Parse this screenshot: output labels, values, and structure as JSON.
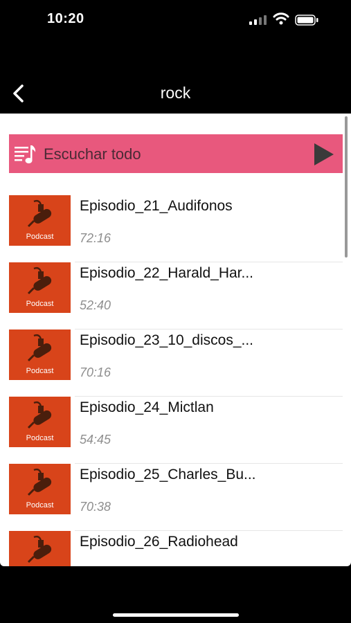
{
  "status_bar": {
    "time": "10:20"
  },
  "nav": {
    "title": "rock",
    "back_icon": "chevron-left-icon"
  },
  "play_all": {
    "label": "Escuchar todo",
    "icon": "playlist-icon",
    "play_icon": "play-icon",
    "color": "#e8587d"
  },
  "thumbnail": {
    "label": "Podcast",
    "color": "#d8441a",
    "icon": "microphone-icon"
  },
  "episodes": [
    {
      "title": "Episodio_21_Audifonos",
      "duration": "72:16"
    },
    {
      "title": "Episodio_22_Harald_Har...",
      "duration": "52:40"
    },
    {
      "title": "Episodio_23_10_discos_...",
      "duration": "70:16"
    },
    {
      "title": "Episodio_24_Mictlan",
      "duration": "54:45"
    },
    {
      "title": "Episodio_25_Charles_Bu...",
      "duration": "70:38"
    },
    {
      "title": "Episodio_26_Radiohead",
      "duration": ""
    }
  ]
}
